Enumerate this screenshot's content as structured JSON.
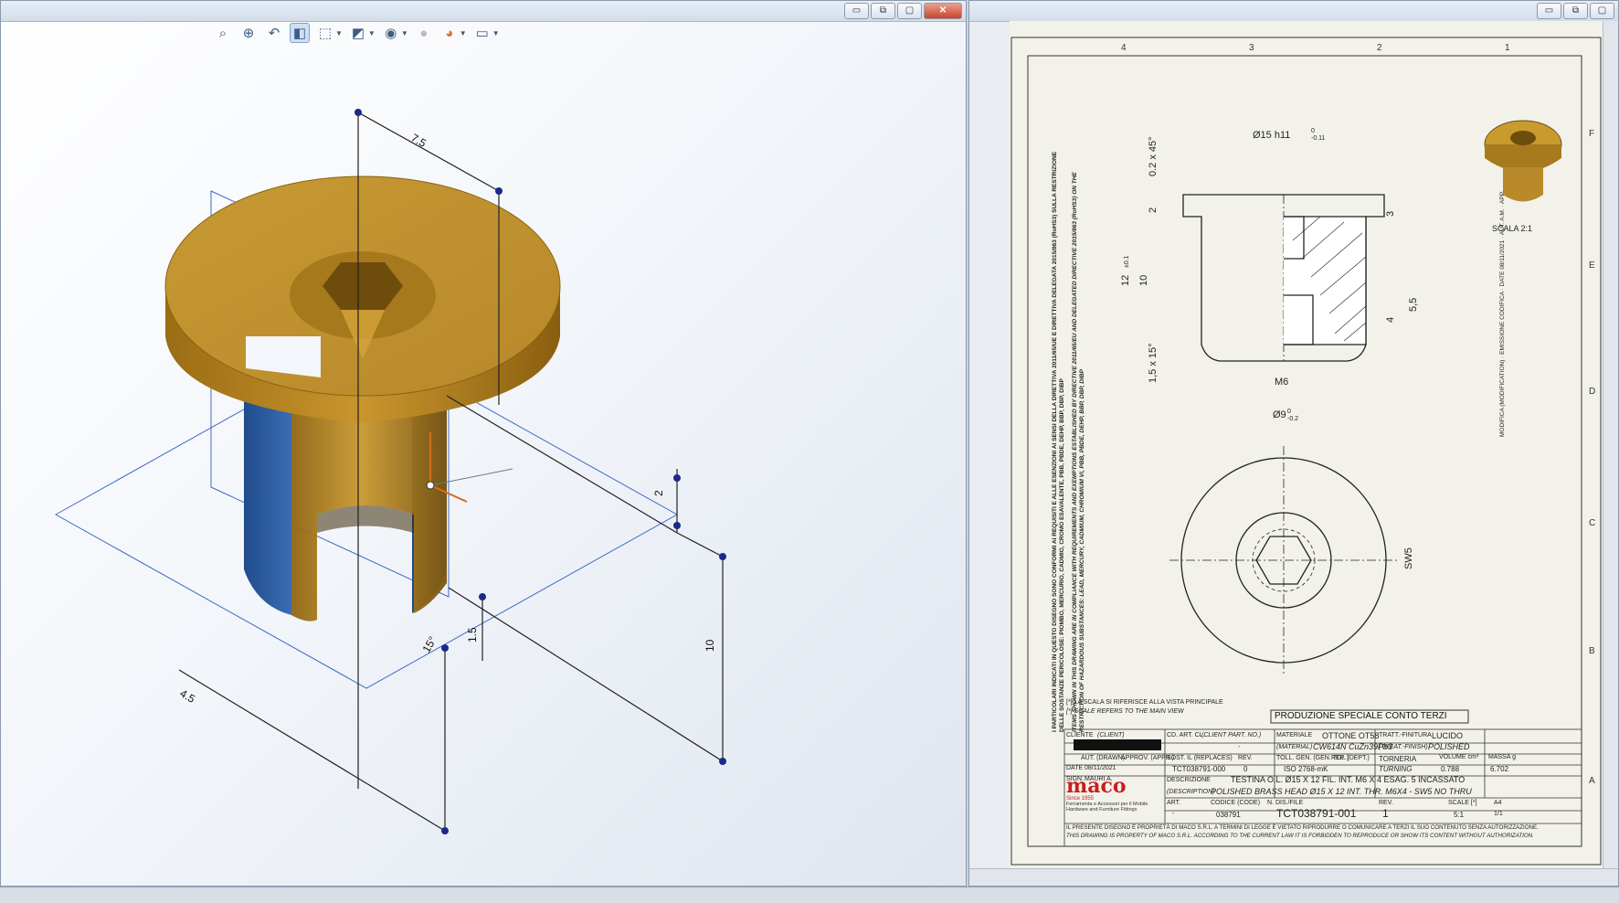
{
  "model_view": {
    "toolbar_icons": [
      "zoom-to-fit-icon",
      "zoom-area-icon",
      "previous-view-icon",
      "section-view-icon",
      "view-orientation-icon",
      "display-style-icon",
      "hide-show-icon",
      "edit-appearance-icon",
      "apply-scene-icon",
      "view-settings-icon"
    ],
    "dims": {
      "d_top": "7.5",
      "d_2": "2",
      "d_10": "10",
      "d_15": "1.5",
      "d_45": "4.5",
      "d_angle": "15°"
    }
  },
  "drawing": {
    "col_labels": [
      "4",
      "3",
      "2",
      "1"
    ],
    "row_labels": [
      "F",
      "E",
      "D",
      "C",
      "B",
      "A"
    ],
    "dims": {
      "phi15": "Ø15 h11",
      "phi15_tol_up": "0",
      "phi15_tol_dn": "-0.11",
      "chamfer_top": "0.2 x 45°",
      "h2": "2",
      "h3": "3",
      "h12": "12",
      "h12_tol": "±0.1",
      "h10": "10",
      "h4": "4",
      "h55": "5,5",
      "chamfer_bot": "1,5 x 15°",
      "m6": "M6",
      "phi9": "Ø9",
      "phi9_tol_up": "0",
      "phi9_tol_dn": "-0.2",
      "sw5": "SW5"
    },
    "scale_label": "SCALA 2:1",
    "compliance_note": "I PARTICOLARI INDICATI IN QUESTO DISEGNO SONO CONFORMI AI REQUISITI E ALLE ESENZIONI AI SENSI DELLA DIRETTIVA 2011/65/UE E DIRETTIVA DELEGATA 2015/863 (RoHS3) SULLA RESTRIZIONE DELLE SOSTANZE PERICOLOSE: PIOMBO, MERCURIO, CADMIO, CROMO ESAVALENTE, PBB, PBDE, DEHP, BBP, DBP, DIBP",
    "compliance_note_en": "ITEMS SHOWN IN THIS DRAWING ARE IN COMPLIANCE WITH REQUIREMENTS AND EXEMPTIONS ESTABLISHED BY DIRECTIVE 2011/65/EU AND DELEGATED DIRECTIVE 2015/863 (RoHS3) ON THE RESTRICTION OF HAZARDOUS SUBSTANCES: LEAD, MERCURY, CADMIUM, CHROMIUM VI, PBB, PBDE, DEHP, BBP, DBP, DIBP",
    "revision_headers": {
      "date": "DATE",
      "date_val": "08/11/2021",
      "aut": "AUT.",
      "aut2": "A.M.",
      "app": "APP.",
      "mod": "MODIFICA (MODIFICATION)",
      "emission": "EMISSIONE CODIFICA"
    },
    "special_note": "PRODUZIONE SPECIALE CONTO TERZI",
    "scale_note_it": "[*] LA SCALA SI RIFERISCE ALLA VISTA PRINCIPALE",
    "scale_note_en": "[*] SCALE REFERS TO THE MAIN VIEW",
    "title_block": {
      "cliente": "CLIENTE",
      "cliente_en": "(CLIENT)",
      "cd_art": "CD. ART. CL.",
      "cd_art_en": "(CLIENT PART. NO.)",
      "cd_art_val": "-",
      "materiale": "MATERIALE",
      "materiale_val": "OTTONE OT58",
      "materiale_en": "(MATERIAL)",
      "materiale_en_val": "CW614N CuZn39Pb3",
      "tratt": "TRATT.-FINITURA",
      "tratt_val": "LUCIDO",
      "tratt_en": "(TREAT.-FINISH)",
      "tratt_en_val": "POLISHED",
      "aut": "AUT. (DRAWN)",
      "aut_val": "MAURI A.",
      "app": "APPROV. (APPR.)",
      "date": "DATE",
      "date_val": "08/11/2021",
      "sign": "SIGN.",
      "sost": "SOST. IL (REPLACES)",
      "sost_val": "TCT038791-000",
      "rev": "REV.",
      "rev_val": "0",
      "toll": "TOLL. GEN. (GEN. TOL.)",
      "toll_val": "ISO 2768-mK",
      "rep": "REP. (DEPT.)",
      "rep_val": "TORNERIA",
      "rep_en": "TURNING",
      "volume": "VOLUME cm³",
      "volume_val": "0.788",
      "massa": "MASSA g",
      "massa_val": "6.702",
      "descr": "DESCRIZIONE",
      "descr_val": "TESTINA O.L. Ø15 X 12 FIL. INT. M6 X 4 ESAG. 5 INCASSATO",
      "descr_en": "(DESCRIPTION)",
      "descr_en_val": "POLISHED BRASS HEAD Ø15 X 12 INT. THR. M6X4 - SW5 NO THRU",
      "art": "ART.",
      "art_val": "-",
      "codice": "CODICE (CODE)",
      "codice_val": "038791",
      "ndis": "N. DIS./FILE",
      "ndis_val": "TCT038791-001",
      "rev2": "REV.",
      "rev2_val": "1",
      "scale": "SCALE [*]",
      "scale_val": "5:1",
      "format": "A4",
      "sheet": "1/1",
      "logo": "maco",
      "since": "Since 1955",
      "tagline1": "Ferramenta e Accessori per il Mobile",
      "tagline2": "Hardware and Furniture Fittings",
      "footer_it": "IL PRESENTE DISEGNO È PROPRIETÀ DI MACO S.R.L. A TERMINI DI LEGGE È VIETATO RIPRODURRE O COMUNICARE A TERZI IL SUO CONTENUTO SENZA AUTORIZZAZIONE.",
      "footer_en": "THIS DRAWING IS PROPERTY OF MACO S.R.L. ACCORDING TO THE CURRENT LAW IT IS FORBIDDEN TO REPRODUCE OR SHOW ITS CONTENT WITHOUT AUTHORIZATION."
    },
    "colors": {
      "brand_red": "#c8201e",
      "brass": "#c99a2e",
      "sheet_bg": "#f3f2ea",
      "line": "#222222"
    }
  }
}
